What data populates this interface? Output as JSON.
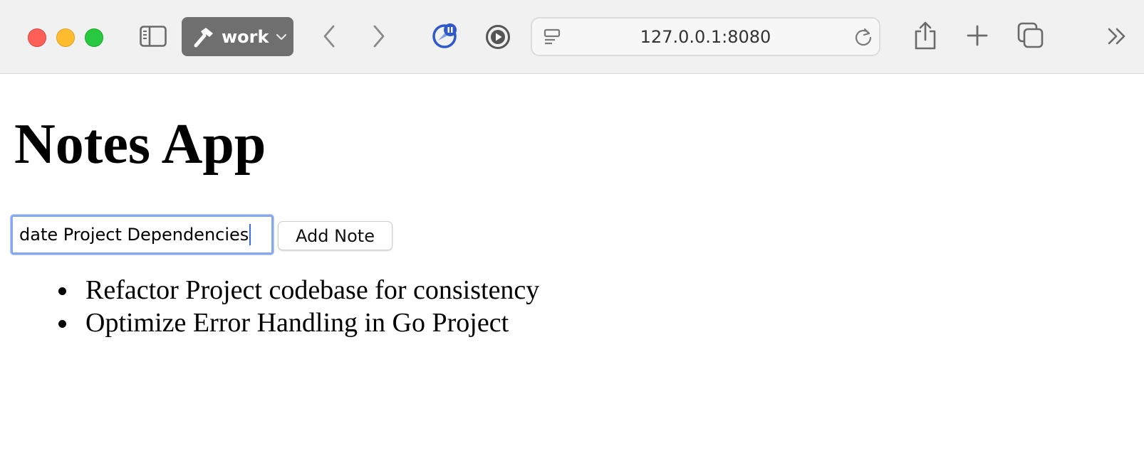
{
  "browser": {
    "url": "127.0.0.1:8080",
    "workspace": {
      "label": "work",
      "icon": "hammer-icon"
    },
    "icons": {
      "sidebar": "sidebar-icon",
      "back": "chevron-left-icon",
      "forward": "chevron-right-icon",
      "extension1": "extension-pause-icon",
      "extension2": "play-circle-icon",
      "page_menu": "page-menu-icon",
      "reload": "reload-icon",
      "share": "share-icon",
      "new_tab": "plus-icon",
      "tabs": "tab-overview-icon",
      "more": "double-chevron-right-icon"
    },
    "colors": {
      "close": "#fe5f57",
      "minimize": "#febc2e",
      "maximize": "#28c840",
      "workspace_bg": "#6f6f6f"
    }
  },
  "app": {
    "title": "Notes App",
    "input_value": "date Project Dependencies",
    "add_button_label": "Add Note",
    "notes": [
      "Refactor Project codebase for consistency",
      "Optimize Error Handling in Go Project"
    ]
  }
}
